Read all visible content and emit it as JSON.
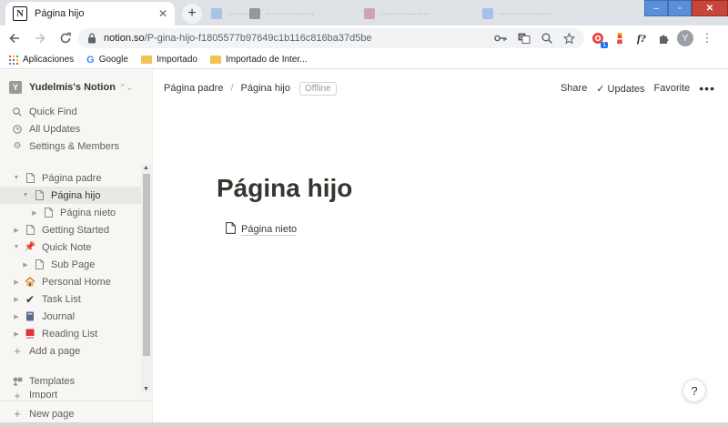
{
  "browser": {
    "active_tab_title": "Página hijo",
    "url_host": "notion.so",
    "url_path": "/P-gina-hijo-f1805577b97649c1b116c816ba37d5be",
    "ext_badge": "1",
    "ext_f_label": "f?",
    "avatar_letter": "Y",
    "bookmarks": [
      "Aplicaciones",
      "Google",
      "Importado",
      "Importado de Inter..."
    ]
  },
  "sidebar": {
    "workspace_badge": "Y",
    "workspace_name": "Yudelmis's Notion",
    "top_items": [
      "Quick Find",
      "All Updates",
      "Settings & Members"
    ],
    "tree": [
      {
        "label": "Página padre",
        "icon": "page-icon",
        "depth": 0,
        "toggle": "open"
      },
      {
        "label": "Página hijo",
        "icon": "page-icon",
        "depth": 1,
        "toggle": "open",
        "active": true
      },
      {
        "label": "Página nieto",
        "icon": "page-icon",
        "depth": 2,
        "toggle": "closed"
      },
      {
        "label": "Getting Started",
        "icon": "page-icon",
        "depth": 0,
        "toggle": "closed"
      },
      {
        "label": "Quick Note",
        "icon": "pushpin-icon",
        "depth": 0,
        "toggle": "open"
      },
      {
        "label": "Sub Page",
        "icon": "page-icon",
        "depth": 1,
        "toggle": "closed"
      },
      {
        "label": "Personal Home",
        "icon": "house-icon",
        "depth": 0,
        "toggle": "closed"
      },
      {
        "label": "Task List",
        "icon": "checkmark-icon",
        "depth": 0,
        "toggle": "closed"
      },
      {
        "label": "Journal",
        "icon": "notebook-icon",
        "depth": 0,
        "toggle": "closed"
      },
      {
        "label": "Reading List",
        "icon": "book-icon",
        "depth": 0,
        "toggle": "closed"
      }
    ],
    "add_page": "Add a page",
    "templates": "Templates",
    "import": "Import",
    "new_page": "New page"
  },
  "topbar": {
    "crumbs": [
      "Página padre",
      "Página hijo"
    ],
    "offline": "Offline",
    "share": "Share",
    "updates": "Updates",
    "favorite": "Favorite",
    "more": "•••"
  },
  "page": {
    "title": "Página hijo",
    "child_link": "Página nieto",
    "help": "?"
  }
}
